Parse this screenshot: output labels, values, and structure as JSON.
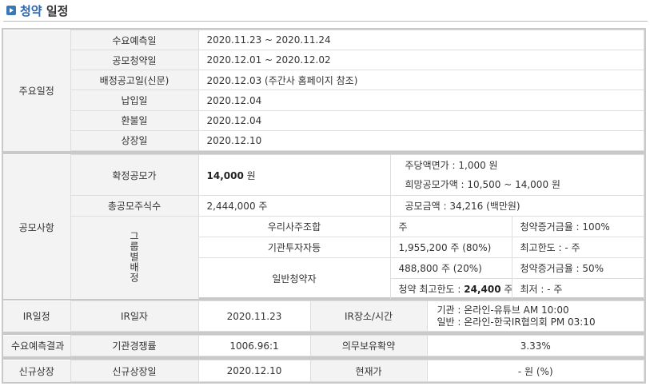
{
  "header": {
    "title_accent": "청약",
    "title_rest": " 일정"
  },
  "schedule": {
    "section_label": "주요일정",
    "rows": [
      {
        "label": "수요예측일",
        "value": "2020.11.23   ~   2020.11.24"
      },
      {
        "label": "공모청약일",
        "value": "2020.12.01   ~   2020.12.02"
      },
      {
        "label": "배정공고일(신문)",
        "value": "2020.12.03 (주간사 홈페이지 참조)"
      },
      {
        "label": "납입일",
        "value": "2020.12.04"
      },
      {
        "label": "환불일",
        "value": "2020.12.04"
      },
      {
        "label": "상장일",
        "value": "2020.12.10"
      }
    ]
  },
  "offering": {
    "section_label": "공모사항",
    "price_label": "확정공모가",
    "price_value": "14,000",
    "price_unit": " 원",
    "par_value": "주당액면가 :  1,000 원",
    "hope_range": "희망공모가액 :  10,500 ~ 14,000 원",
    "shares_label": "총공모주식수",
    "shares_value": "2,444,000 주",
    "amount_value": "공모금액 : 34,216 (백만원)",
    "group_label": "그룹별배정",
    "groups": {
      "employee": {
        "label": "우리사주조합",
        "shares": "주",
        "extra": "청약증거금율 : 100%"
      },
      "institution": {
        "label": "기관투자자등",
        "shares": "1,955,200 주  (80%)",
        "extra": "최고한도 :  - 주"
      },
      "general": {
        "label": "일반청약자",
        "shares": "488,800 주  (20%)",
        "extra": "청약증거금율 : 50%",
        "max_prefix": "청약 최고한도 :",
        "max_value": "24,400",
        "max_unit": " 주",
        "min_text": "최저 :  - 주"
      }
    }
  },
  "ir": {
    "section_label": "IR일정",
    "date_label": "IR일자",
    "date_value": "2020.11.23",
    "place_label": "IR장소/시간",
    "place_line1": "기관 : 온라인-유튜브 AM 10:00",
    "place_line2": "일반 : 온라인-한국IR협의회 PM 03:10"
  },
  "demand": {
    "section_label": "수요예측결과",
    "comp_label": "기관경쟁률",
    "comp_value": "1006.96:1",
    "lockup_label": "의무보유확약",
    "lockup_value": "3.33%"
  },
  "listing": {
    "section_label": "신규상장",
    "date_label": "신규상장일",
    "date_value": "2020.12.10",
    "price_label": "현재가",
    "price_value": "- 원 (%)"
  }
}
